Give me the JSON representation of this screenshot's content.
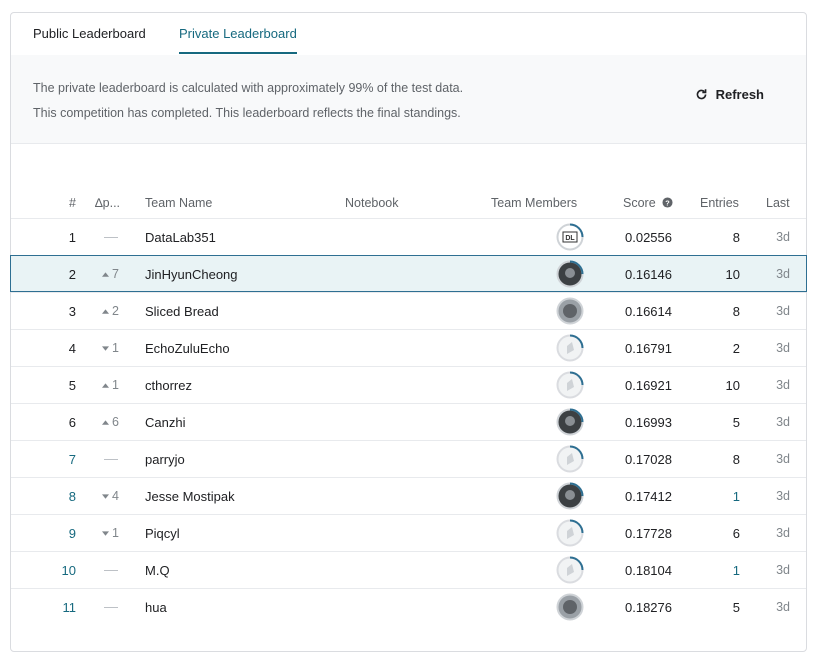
{
  "tabs": [
    {
      "label": "Public Leaderboard",
      "active": false
    },
    {
      "label": "Private Leaderboard",
      "active": true
    }
  ],
  "info": {
    "line1": "The private leaderboard is calculated with approximately 99% of the test data.",
    "line2": "This competition has completed. This leaderboard reflects the final standings."
  },
  "refresh_label": "Refresh",
  "columns": {
    "rank": "#",
    "delta": "∆p...",
    "team": "Team Name",
    "notebook": "Notebook",
    "members": "Team Members",
    "score": "Score",
    "entries": "Entries",
    "last": "Last"
  },
  "rows": [
    {
      "rank": "1",
      "delta": "",
      "team": "DataLab351",
      "score": "0.02556",
      "entries": "8",
      "last": "3d",
      "avatar": "dl-logo"
    },
    {
      "rank": "2",
      "delta": "7",
      "dir": "up",
      "team": "JinHyunCheong",
      "score": "0.16146",
      "entries": "10",
      "last": "3d",
      "avatar": "photo-dark"
    },
    {
      "rank": "3",
      "delta": "2",
      "dir": "up",
      "team": "Sliced Bread",
      "score": "0.16614",
      "entries": "8",
      "last": "3d",
      "avatar": "photo-gray"
    },
    {
      "rank": "4",
      "delta": "1",
      "dir": "down",
      "team": "EchoZuluEcho",
      "score": "0.16791",
      "entries": "2",
      "last": "3d",
      "avatar": "default"
    },
    {
      "rank": "5",
      "delta": "1",
      "dir": "up",
      "team": "cthorrez",
      "score": "0.16921",
      "entries": "10",
      "last": "3d",
      "avatar": "default"
    },
    {
      "rank": "6",
      "delta": "6",
      "dir": "up",
      "team": "Canzhi",
      "score": "0.16993",
      "entries": "5",
      "last": "3d",
      "avatar": "photo-dark"
    },
    {
      "rank": "7",
      "delta": "",
      "team": "parryjo",
      "score": "0.17028",
      "entries": "8",
      "last": "3d",
      "avatar": "default"
    },
    {
      "rank": "8",
      "delta": "4",
      "dir": "down",
      "team": "Jesse Mostipak",
      "score": "0.17412",
      "entries": "1",
      "last": "3d",
      "avatar": "photo-dark"
    },
    {
      "rank": "9",
      "delta": "1",
      "dir": "down",
      "team": "Piqcyl",
      "score": "0.17728",
      "entries": "6",
      "last": "3d",
      "avatar": "default"
    },
    {
      "rank": "10",
      "delta": "",
      "team": "M.Q",
      "score": "0.18104",
      "entries": "1",
      "last": "3d",
      "avatar": "default"
    },
    {
      "rank": "11",
      "delta": "",
      "team": "hua",
      "score": "0.18276",
      "entries": "5",
      "last": "3d",
      "avatar": "photo-gray"
    }
  ],
  "colors": {
    "accent": "#16697f",
    "selected_row_bg": "#e9f3f5",
    "selected_row_border": "#2e6f92"
  }
}
